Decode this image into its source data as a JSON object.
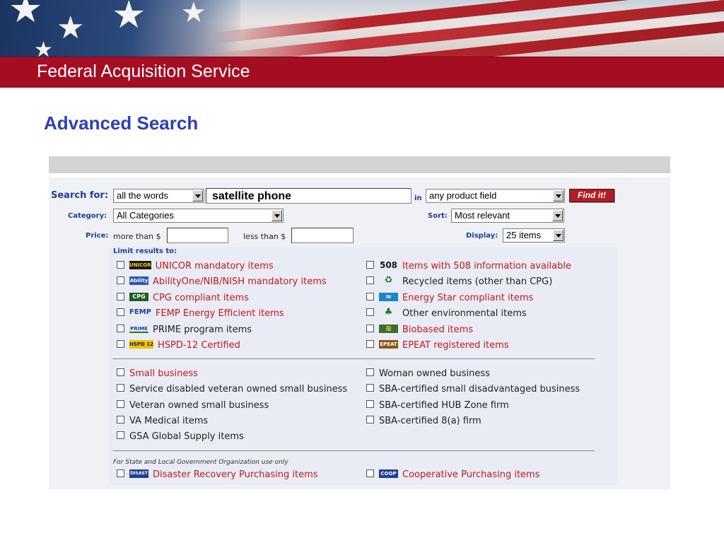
{
  "header": {
    "title": "Federal Acquisition Service"
  },
  "page": {
    "title": "Advanced Search"
  },
  "search": {
    "label": "Search for:",
    "mode": "all the words",
    "query": "satellite phone",
    "in_label": "in",
    "field": "any product field",
    "button": "Find it!"
  },
  "category": {
    "label": "Category:",
    "value": "All Categories"
  },
  "sort": {
    "label": "Sort:",
    "value": "Most relevant"
  },
  "price": {
    "label": "Price:",
    "more_than": "more than $",
    "less_than": "less than $"
  },
  "display": {
    "label": "Display:",
    "value": "25 items"
  },
  "limits": {
    "title": "Limit results to:",
    "group1_left": [
      {
        "icon": "unicor-icon",
        "icon_text": "UNICOR",
        "label": "UNICOR mandatory items",
        "color": "#c0191f"
      },
      {
        "icon": "abilityone-icon",
        "icon_text": "Ability",
        "label": "AbilityOne/NIB/NISH mandatory items",
        "color": "#c0191f"
      },
      {
        "icon": "cpg-icon",
        "icon_text": "CPG",
        "label": "CPG compliant items",
        "color": "#c0191f"
      },
      {
        "icon": "femp-icon",
        "icon_text": "FEMP",
        "label": "FEMP Energy Efficient items",
        "color": "#c0191f"
      },
      {
        "icon": "prime-icon",
        "icon_text": "PRIME",
        "label": "PRIME program items",
        "color": "#222222"
      },
      {
        "icon": "hspd-icon",
        "icon_text": "HSPD 12",
        "label": "HSPD-12 Certified",
        "color": "#c0191f"
      }
    ],
    "group1_right": [
      {
        "icon": "508-icon",
        "icon_text": "508",
        "label": "Items with 508 information available",
        "color": "#c0191f"
      },
      {
        "icon": "recycle-icon",
        "icon_text": "♻",
        "label": "Recycled items (other than CPG)",
        "color": "#222222"
      },
      {
        "icon": "energy-star-icon",
        "icon_text": "≈",
        "label": "Energy Star compliant items",
        "color": "#c0191f"
      },
      {
        "icon": "environment-icon",
        "icon_text": "♣",
        "label": "Other environmental items",
        "color": "#222222"
      },
      {
        "icon": "biobased-icon",
        "icon_text": "≋",
        "label": "Biobased items",
        "color": "#c0191f"
      },
      {
        "icon": "epeat-icon",
        "icon_text": "EPEAT",
        "label": "EPEAT registered items",
        "color": "#c0191f"
      }
    ],
    "group2_left": [
      {
        "label": "Small business",
        "color": "#c0191f"
      },
      {
        "label": "Service disabled veteran owned small business",
        "color": "#222222"
      },
      {
        "label": "Veteran owned small business",
        "color": "#222222"
      },
      {
        "label": "VA Medical items",
        "color": "#222222"
      },
      {
        "label": "GSA Global Supply items",
        "color": "#222222"
      }
    ],
    "group2_right": [
      {
        "label": "Woman owned business",
        "color": "#222222"
      },
      {
        "label": "SBA-certified small disadvantaged business",
        "color": "#222222"
      },
      {
        "label": "SBA-certified HUB Zone firm",
        "color": "#222222"
      },
      {
        "label": "SBA-certified 8(a) firm",
        "color": "#222222"
      }
    ],
    "note": "For State and Local Government Organization use only",
    "group3_left": [
      {
        "icon": "disaster-icon",
        "icon_text": "DISAST",
        "label": "Disaster Recovery Purchasing items",
        "color": "#c0191f"
      }
    ],
    "group3_right": [
      {
        "icon": "coop-icon",
        "icon_text": "COOP",
        "label": "Cooperative Purchasing items",
        "color": "#c0191f"
      }
    ]
  }
}
